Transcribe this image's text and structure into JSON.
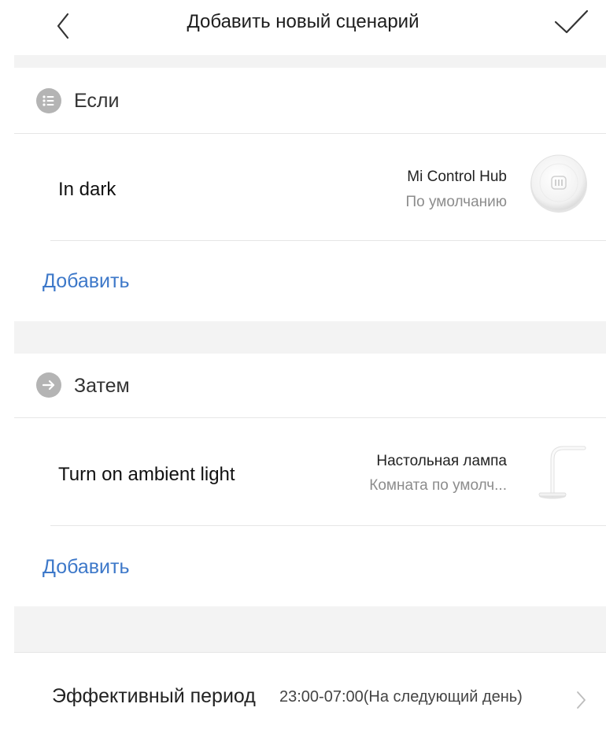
{
  "header": {
    "title": "Добавить новый сценарий",
    "back_icon": "chevron-left-icon",
    "save_icon": "checkmark-icon"
  },
  "if_section": {
    "label": "Если",
    "icon": "list-icon",
    "rule": {
      "name": "In dark",
      "device_name": "Mi Control Hub",
      "device_room": "По умолчанию",
      "device_image": "hub-device-icon"
    },
    "add_label": "Добавить"
  },
  "then_section": {
    "label": "Затем",
    "icon": "arrow-right-icon",
    "rule": {
      "name": "Turn on ambient light",
      "device_name": "Настольная лампа",
      "device_room": "Комната по умолч...",
      "device_image": "desk-lamp-icon"
    },
    "add_label": "Добавить"
  },
  "period": {
    "label": "Эффективный период",
    "value": "23:00-07:00(На следующий день)",
    "chevron_icon": "chevron-right-icon"
  },
  "colors": {
    "link": "#3d78c9",
    "separator": "#f3f3f3",
    "section_icon": "#b4b4b4"
  }
}
